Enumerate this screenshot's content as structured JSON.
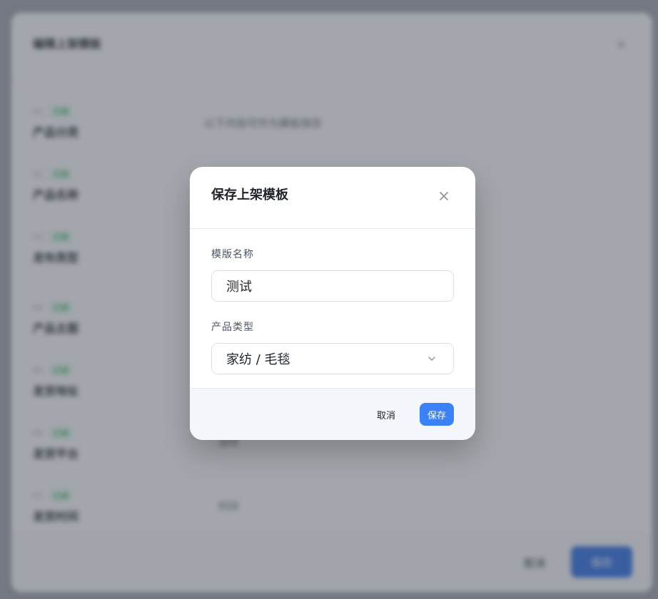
{
  "background": {
    "title": "编辑上架模板",
    "close_icon": "close-icon",
    "nav_items": [
      {
        "num": "01",
        "status": "已填",
        "label": "产品分类"
      },
      {
        "num": "02",
        "status": "已填",
        "label": "产品名称"
      },
      {
        "num": "03",
        "status": "已填",
        "label": "发布类型"
      },
      {
        "num": "04",
        "status": "已填",
        "label": "产品主图"
      },
      {
        "num": "05",
        "status": "已填",
        "label": "发货地址"
      },
      {
        "num": "06",
        "status": "已填",
        "label": "发货平台"
      },
      {
        "num": "07",
        "status": "已填",
        "label": "发货时间"
      }
    ],
    "hint": "以下内容可作为模板保存",
    "field_a": "选项",
    "field_b": "时间",
    "cancel_label": "取消",
    "save_label": "保存"
  },
  "modal": {
    "title": "保存上架模板",
    "close_icon": "close-icon",
    "name_label": "模版名称",
    "name_value": "测试",
    "type_label": "产品类型",
    "type_value": "家纺 / 毛毯",
    "chevron_icon": "chevron-down-icon",
    "cancel_label": "取消",
    "save_label": "保存"
  },
  "colors": {
    "primary": "#3b82f6",
    "success": "#1f9d55",
    "overlay": "#464a56"
  }
}
